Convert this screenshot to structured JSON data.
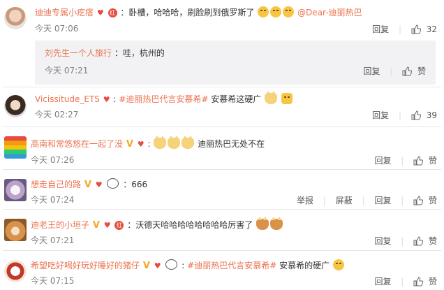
{
  "labels": {
    "reply": "回复",
    "like": "赞",
    "report": "举报",
    "block": "屏蔽"
  },
  "comments": [
    {
      "user": "迪迪专属小疙瘩",
      "text": "：卧槽，哈哈哈，刷脸刷到俄罗斯了",
      "mention": "@Dear-迪丽热巴",
      "time": "今天 07:06",
      "likes": "32",
      "nested": {
        "user": "刘先生一个人旅行",
        "text": "：哇，杭州的",
        "time": "今天 07:21"
      }
    },
    {
      "user": "Vicissitude_ETS",
      "topic": "#迪丽热巴代言安慕希#",
      "text": " 安慕希这硬广",
      "time": "今天 02:27",
      "likes": "39"
    },
    {
      "user": "高南和常悠悠在一起了没",
      "text": "迪丽热巴无处不在",
      "time": "今天 07:26"
    },
    {
      "user": "想走自己的路",
      "text": "：666",
      "time": "今天 07:24"
    },
    {
      "user": "迪老王的小垣子",
      "text": "：沃德天哈哈哈哈哈哈哈哈厉害了",
      "time": "今天 07:21"
    },
    {
      "user": "希望吃好喝好玩好睡好的猪仔",
      "topic": "#迪丽热巴代言安慕希#",
      "text": " 安慕希的硬广",
      "time": "今天 07:15"
    }
  ],
  "colors": {
    "accent": "#eb7350",
    "muted": "#808080",
    "panel": "#f2f2f5"
  }
}
